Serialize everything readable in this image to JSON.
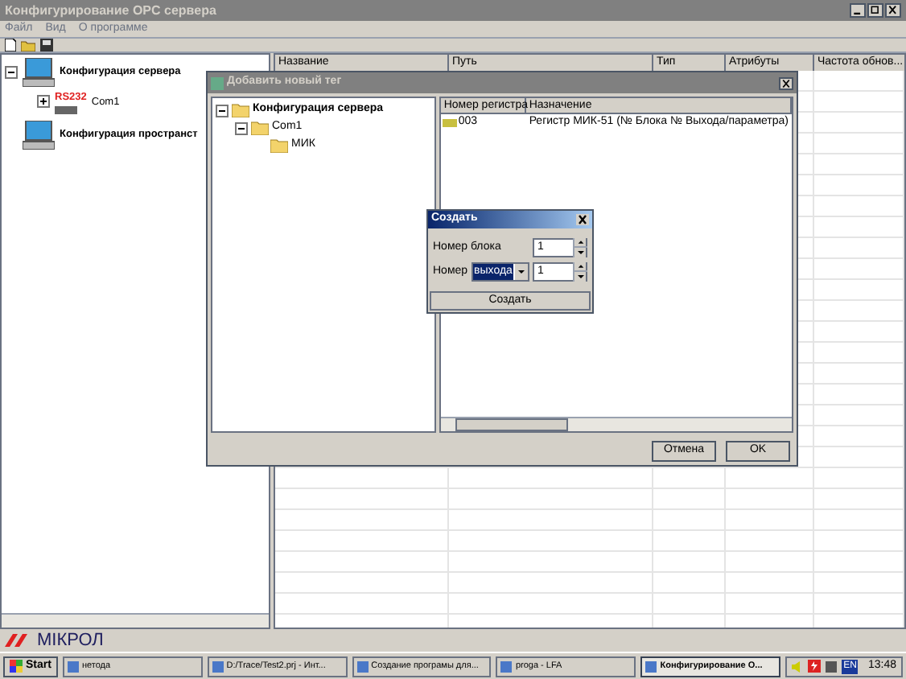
{
  "window": {
    "title": "Конфигурирование OPC сервера"
  },
  "menu": [
    "Файл",
    "Вид",
    "О программе"
  ],
  "server_tree": [
    {
      "label": "Конфигурация сервера",
      "expanded": true,
      "children": [
        {
          "label": "Com1",
          "badge": "RS232",
          "expanded": false
        }
      ]
    },
    {
      "label": "Конфигурация пространст"
    }
  ],
  "grid": {
    "columns": [
      "Название",
      "Путь",
      "Тип",
      "Атрибуты",
      "Частота обнов..."
    ]
  },
  "logo": "МІКРОЛ",
  "add_tag_dialog": {
    "title": "Добавить новый тег",
    "tree": [
      {
        "label": "Конфигурация сервера",
        "expanded": true,
        "children": [
          {
            "label": "Com1",
            "expanded": true,
            "children": [
              {
                "label": "МИК"
              }
            ]
          }
        ]
      }
    ],
    "columns": [
      "Номер регистра",
      "Назначение"
    ],
    "rows": [
      {
        "register": "003",
        "purpose": "Регистр МИК-51 (№ Блока № Выхода/параметра)"
      }
    ],
    "buttons": [
      "Отмена",
      "OK"
    ]
  },
  "create_dialog": {
    "title": "Создать",
    "block_label": "Номер блока",
    "block_value": "1",
    "number_label": "Номер",
    "number_type": "выхода",
    "number_value": "1",
    "button": "Создать"
  },
  "taskbar": {
    "start": "Start",
    "items": [
      {
        "label": "нетода",
        "active": false
      },
      {
        "label": "D:/Trace/Test2.prj - Инт...",
        "active": false
      },
      {
        "label": "Создание програмы для...",
        "active": false
      },
      {
        "label": "proga - LFA",
        "active": false
      },
      {
        "label": "Конфигурирование О...",
        "active": true
      }
    ],
    "language": "EN",
    "clock": "13:48"
  }
}
